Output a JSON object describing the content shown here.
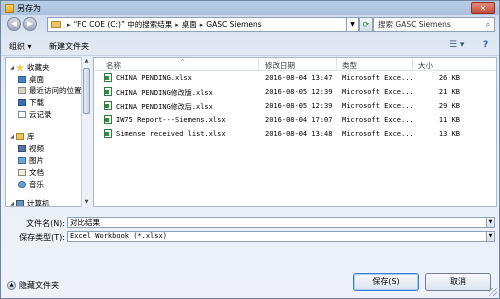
{
  "window": {
    "title": "另存为",
    "close_label": "✕"
  },
  "address": {
    "crumbs": [
      "“FC COE (C:)” 中的搜索结果",
      "桌面",
      "GASC Siemens"
    ],
    "search_placeholder": "搜索 GASC Siemens"
  },
  "toolbar": {
    "organize": "组织 ▾",
    "new_folder": "新建文件夹"
  },
  "nav": {
    "favorites": "收藏夹",
    "desktop": "桌面",
    "recent": "最近访问的位置",
    "downloads": "下载",
    "cloud": "云记录",
    "libraries": "库",
    "videos": "视频",
    "pictures": "图片",
    "documents": "文档",
    "music": "音乐",
    "computer": "计算机"
  },
  "columns": {
    "name": "名称",
    "date": "修改日期",
    "type": "类型",
    "size": "大小"
  },
  "files": [
    {
      "name": "CHINA PENDING.xlsx",
      "date": "2016-08-04 13:47",
      "type": "Microsoft Exce...",
      "size": "26 KB"
    },
    {
      "name": "CHINA PENDING修改版.xlsx",
      "date": "2016-08-05 12:39",
      "type": "Microsoft Exce...",
      "size": "21 KB"
    },
    {
      "name": "CHINA PENDING修改后.xlsx",
      "date": "2016-08-05 12:39",
      "type": "Microsoft Exce...",
      "size": "29 KB"
    },
    {
      "name": "IW75 Report---Siemens.xlsx",
      "date": "2016-08-04 17:07",
      "type": "Microsoft Exce...",
      "size": "11 KB"
    },
    {
      "name": "Simense received list.xlsx",
      "date": "2016-08-04 13:48",
      "type": "Microsoft Exce...",
      "size": "13 KB"
    }
  ],
  "form": {
    "filename_label": "文件名(N):",
    "filename_value": "对比结果",
    "filetype_label": "保存类型(T):",
    "filetype_value": "Excel Workbook (*.xlsx)"
  },
  "buttons": {
    "hide_folders": "隐藏文件夹",
    "save": "保存(S)",
    "cancel": "取消"
  }
}
